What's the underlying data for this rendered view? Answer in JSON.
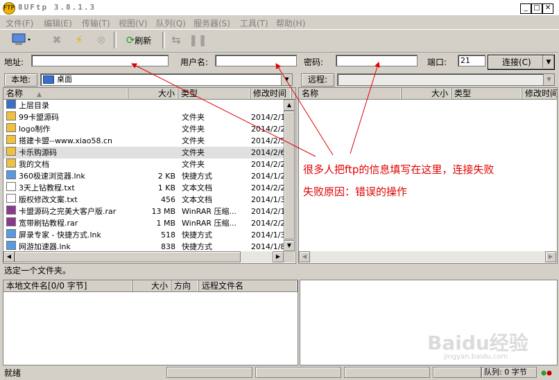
{
  "window": {
    "title": "8UFtp 3.8.1.3",
    "icon_label": "FTP"
  },
  "menu": [
    {
      "label": "文件(F)"
    },
    {
      "label": "编辑(E)"
    },
    {
      "label": "传输(T)"
    },
    {
      "label": "视图(V)"
    },
    {
      "label": "队列(Q)"
    },
    {
      "label": "服务器(S)"
    },
    {
      "label": "工具(T)"
    },
    {
      "label": "帮助(H)"
    }
  ],
  "toolbar": {
    "refresh_label": "刷新"
  },
  "connection": {
    "address_label": "地址:",
    "address_value": "",
    "username_label": "用户名:",
    "username_value": "",
    "password_label": "密码:",
    "password_value": "",
    "port_label": "端口:",
    "port_value": "21",
    "connect_label": "连接(C)"
  },
  "local": {
    "label": "本地:",
    "path": "桌面",
    "columns": [
      "名称",
      "大小",
      "类型",
      "修改时间"
    ],
    "rows": [
      {
        "name": "上层目录",
        "size": "",
        "type": "",
        "date": ""
      },
      {
        "name": "99卡盟源码",
        "size": "",
        "type": "文件夹",
        "date": "2014/2/1"
      },
      {
        "name": "logo制作",
        "size": "",
        "type": "文件夹",
        "date": "2014/2/2"
      },
      {
        "name": "搭建卡盟--www.xiao58.cn",
        "size": "",
        "type": "文件夹",
        "date": "2014/2/5"
      },
      {
        "name": "卡乐购源码",
        "size": "",
        "type": "文件夹",
        "date": "2014/2/6"
      },
      {
        "name": "我的文档",
        "size": "",
        "type": "文件夹",
        "date": "2014/2/2"
      },
      {
        "name": "360极速浏览器.lnk",
        "size": "2 KB",
        "type": "快捷方式",
        "date": "2014/1/2"
      },
      {
        "name": "3天上钻教程.txt",
        "size": "1 KB",
        "type": "文本文档",
        "date": "2014/2/2"
      },
      {
        "name": "版权修改文案.txt",
        "size": "456",
        "type": "文本文档",
        "date": "2014/1/3"
      },
      {
        "name": "卡盟源码之完美大客户版.rar",
        "size": "13 MB",
        "type": "WinRAR 压缩...",
        "date": "2014/2/1"
      },
      {
        "name": "宽带刷钻教程.rar",
        "size": "1 MB",
        "type": "WinRAR 压缩...",
        "date": "2014/2/2"
      },
      {
        "name": "屏录专家 - 快捷方式.lnk",
        "size": "518",
        "type": "快捷方式",
        "date": "2014/1/3"
      },
      {
        "name": "网游加速器.lnk",
        "size": "838",
        "type": "快捷方式",
        "date": "2014/1/8"
      }
    ],
    "status": "选定一个文件夹。"
  },
  "remote": {
    "label": "远程:",
    "path": "",
    "columns": [
      "名称",
      "大小",
      "类型",
      "修改时间"
    ]
  },
  "queue": {
    "columns": [
      "本地文件名[0/0 字节]",
      "大小",
      "方向",
      "远程文件名"
    ]
  },
  "annotation": {
    "line1": "很多人把ftp的信息填写在这里，连接失败",
    "line2": "失败原因：错误的操作",
    "color": "#e00000"
  },
  "statusbar": {
    "ready": "就绪",
    "queue": "队列: 0 字节"
  },
  "watermark": {
    "text": "Baidu经验",
    "sub": "jingyan.baidu.com"
  }
}
